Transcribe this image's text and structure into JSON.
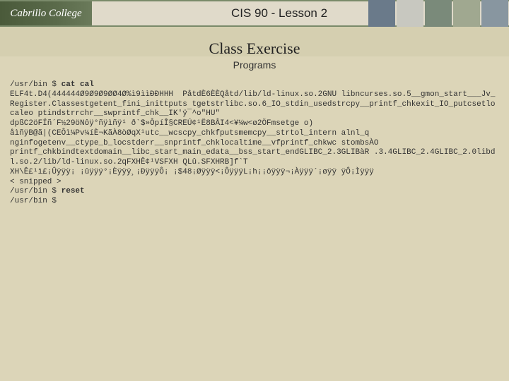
{
  "header": {
    "logo_text": "Cabrillo College",
    "course": "CIS 90 - Lesson 2"
  },
  "page": {
    "title": "Class Exercise",
    "subtitle": "Programs"
  },
  "term": {
    "prompt1": "/usr/bin $ ",
    "cmd1": "cat cal",
    "dump": "ELF4t.D4(444444Ø9Ø9Ø9ØØ4Ø%ì9ììÐÐHHH  PåtdÈ6ÈÈQåtd/lib/ld-linux.so.2GNU libncurses.so.5__gmon_start___Jv_Register.Classestgetent_fini_inittputs tgetstrlibc.so.6_IO_stdin_usedstrcpy__printf_chkexit_IO_putcsetlocaleo ptindstrrchr__swprintf_chk__IK'ÿ¯^o\"HU\"\ndpßC2öFÏñ´F½29öNôÿ°ñÿìñÿ¹ ð`$»ÔpíÎ§CREÚ¢¹Ë8BÂI4<¥¼w<ø2ÖFmsetge o)\nåìñÿB@ã|(CEÔì¼Pv¼íÈ¬KãÀ8òØqX¹utc__wcscpy_chkfputsmemcpy__strtol_intern alnl_q\nnginfogetenv__ctype_b_locstderr__snprintf_chklocaltime__vfprintf_chkwc stombsÀO\nprintf_chkbindtextdomain__libc_start_main_edata__bss_start_endGLIBC_2.3GLIBàR .3.4GLIBC_2.4GLIBC_2.0libdl.so.2/lib/ld-linux.so.2qFXHÊ¢¹VSFXH QLû.SFXHRB]f`T\nXH\\Ê£¹ì£¡Ûÿÿÿ¡ ¡ûÿÿÿ°¡Èÿÿÿ¸¡ÐÿÿÿÔ¡ ¡$48¡Øÿÿÿ<¡ÔÿÿÿL¡h¡¡ôÿÿÿ¬¡Àÿÿÿ´¡øÿÿ ÿÔ¡Ìÿÿÿ",
    "snip": "< snipped >",
    "prompt2": "/usr/bin $ ",
    "cmd2": "reset",
    "prompt3": "/usr/bin $"
  }
}
